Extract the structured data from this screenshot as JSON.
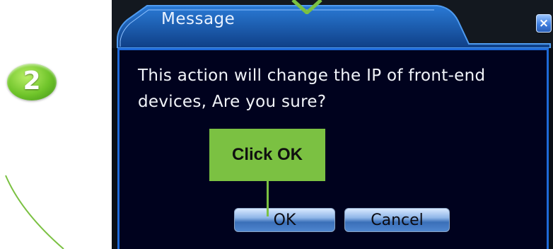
{
  "guide": {
    "step_number": "2",
    "callout_text": "Click OK",
    "accent_color": "#7bc142"
  },
  "dialog": {
    "title": "Message",
    "close_label": "×",
    "message": "This action will change the IP of front-end\n devices, Are you sure?",
    "buttons": {
      "ok_label": "OK",
      "cancel_label": "Cancel"
    },
    "colors": {
      "frame": "#1e69d8",
      "background": "#00021e",
      "title_tab": "#1c5fb4"
    }
  },
  "icons": {
    "close": "close-icon",
    "step": "step-2-badge",
    "arrow": "down-arrow-icon"
  }
}
